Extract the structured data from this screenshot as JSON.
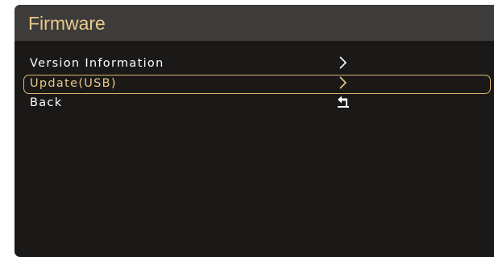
{
  "header": {
    "title": "Firmware"
  },
  "menu": {
    "items": [
      {
        "label": "Version Information",
        "icon": "chevron-right-icon",
        "selected": false
      },
      {
        "label": "Update(USB)",
        "icon": "chevron-right-icon",
        "selected": true
      },
      {
        "label": "Back",
        "icon": "return-icon",
        "selected": false
      }
    ]
  },
  "colors": {
    "accent": "#e8c98a",
    "background": "#1b1918",
    "header": "#3d3c3b",
    "text": "#ffffff"
  }
}
